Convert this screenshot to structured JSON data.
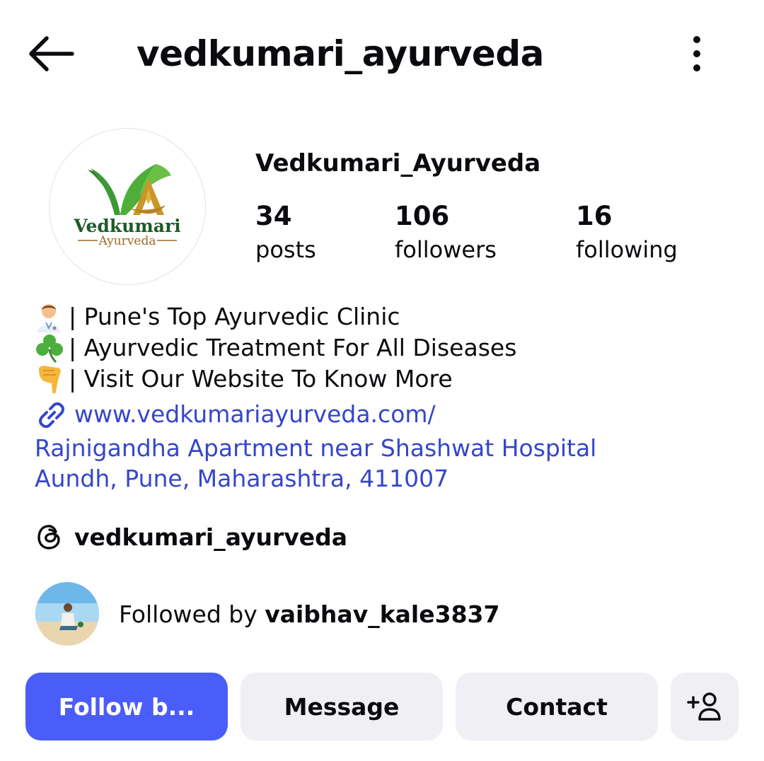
{
  "header": {
    "username": "vedkumari_ayurveda",
    "back_icon": "arrow-left-icon",
    "menu_icon": "vertical-dots-icon"
  },
  "profile": {
    "display_name": "Vedkumari_Ayurveda",
    "avatar_logo": {
      "name": "Vedkumari",
      "sub": "Ayurveda"
    },
    "stats": [
      {
        "value": "34",
        "label": "posts"
      },
      {
        "value": "106",
        "label": "followers"
      },
      {
        "value": "16",
        "label": "following"
      }
    ]
  },
  "bio": {
    "lines": [
      {
        "icon": "doctor-emoji",
        "text": "| Pune's Top Ayurvedic Clinic"
      },
      {
        "icon": "shamrock-emoji",
        "text": "| Ayurvedic Treatment For All Diseases"
      },
      {
        "icon": "pointing-down-emoji",
        "text": "| Visit Our Website To Know More"
      }
    ],
    "link_icon": "link-icon",
    "website": "www.vedkumariayurveda.com/",
    "address_line1": "Rajnigandha Apartment near Shashwat Hospital",
    "address_line2": "Aundh, Pune, Maharashtra, 411007"
  },
  "threads": {
    "icon": "threads-icon",
    "handle": "vedkumari_ayurveda"
  },
  "followed_by": {
    "prefix": "Followed by ",
    "username": "vaibhav_kale3837"
  },
  "actions": {
    "follow_label": "Follow b...",
    "message_label": "Message",
    "contact_label": "Contact",
    "add_user_icon": "add-person-icon"
  },
  "colors": {
    "accent": "#4a5df9",
    "link": "#3546c9",
    "button_bg": "#efeff4",
    "text": "#0b0b0f"
  }
}
